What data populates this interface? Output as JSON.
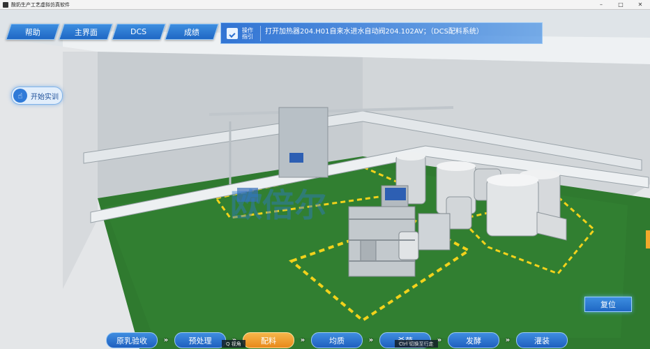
{
  "window": {
    "title": "酸奶生产工艺虚拟仿真软件"
  },
  "nav": {
    "help": "帮助",
    "main": "主界面",
    "dcs": "DCS",
    "score": "成绩"
  },
  "guide": {
    "label": "操作指引",
    "text": "打开加热器204.H01自来水进水自动阀204.102AV；（DCS配料系统）"
  },
  "start_button": {
    "label": "开始实训"
  },
  "reset_button": {
    "label": "复位"
  },
  "steps": [
    {
      "label": "原乳验收",
      "active": false
    },
    {
      "label": "预处理",
      "active": false
    },
    {
      "label": "配料",
      "active": true
    },
    {
      "label": "均质",
      "active": false
    },
    {
      "label": "杀菌",
      "active": false
    },
    {
      "label": "发酵",
      "active": false
    },
    {
      "label": "灌装",
      "active": false
    }
  ],
  "hints": {
    "view": "Q  视角",
    "walk": "Ctrl 切换至行走"
  },
  "watermark": "欧倍尔",
  "colors": {
    "floor": "#2f7a2f",
    "accent": "#1f67c4",
    "active_step": "#e8891a"
  }
}
